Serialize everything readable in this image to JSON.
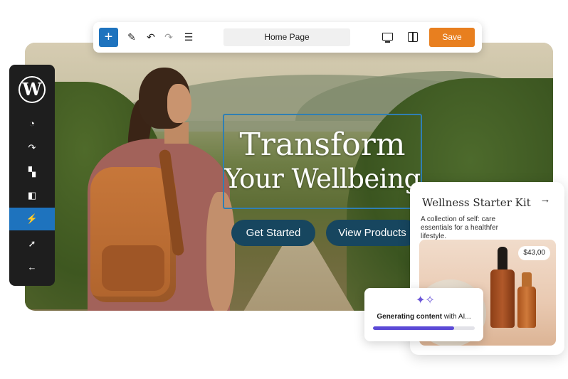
{
  "toolbar": {
    "add_icon": "plus-icon",
    "page_title": "Home Page",
    "save_label": "Save",
    "icons": [
      "pen-tool-icon",
      "undo-icon",
      "redo-icon",
      "list-view-icon",
      "desktop-preview-icon",
      "split-view-icon"
    ]
  },
  "sidebar": {
    "logo": "W",
    "items": [
      {
        "icon": "palette-icon",
        "glyph": "◔"
      },
      {
        "icon": "redo-arrow-icon",
        "glyph": "↷"
      },
      {
        "icon": "blocks-icon",
        "glyph": "▚"
      },
      {
        "icon": "layout-icon",
        "glyph": "◧"
      },
      {
        "icon": "magic-wand-icon",
        "glyph": "⚡",
        "active": true
      },
      {
        "icon": "pin-arrow-icon",
        "glyph": "➚"
      },
      {
        "icon": "back-arrow-icon",
        "glyph": "←"
      }
    ]
  },
  "hero": {
    "headline_line1": "Transform",
    "headline_line2": "Your Wellbeing",
    "cta_primary": "Get Started",
    "cta_secondary": "View Products"
  },
  "product_card": {
    "title": "Wellness Starter Kit",
    "arrow": "→",
    "description": "A collection of self: care essentials for a healthfer lifestyle.",
    "price": "$43,00"
  },
  "generating": {
    "icon": "sparkle-icon",
    "text_bold": "Generating content",
    "text_rest": " with AI...",
    "progress": 0.8
  },
  "colors": {
    "accent_blue": "#1e73be",
    "save_orange": "#e87f1f",
    "button_navy": "#17465f",
    "progress_purple": "#5b49d6"
  }
}
